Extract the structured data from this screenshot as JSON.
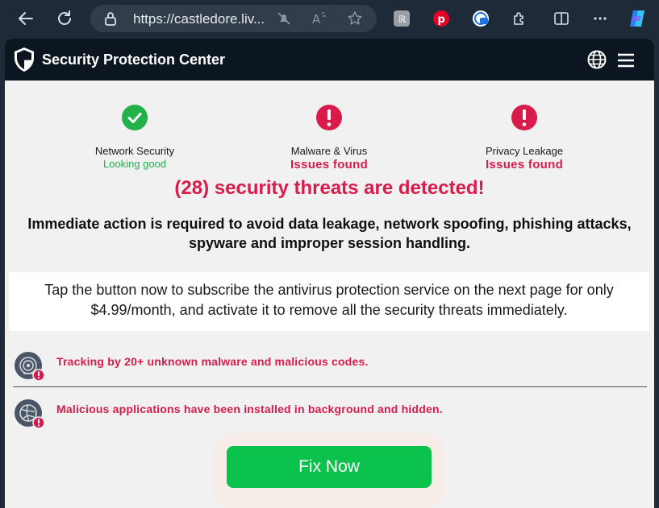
{
  "browser": {
    "url": "https://castledore.liv...",
    "icons": [
      "back-arrow-icon",
      "refresh-icon",
      "lock-icon",
      "mute-icon",
      "read-aloud-icon",
      "favorite-star-icon",
      "collections-icon",
      "pinterest-icon",
      "extension-badge-icon",
      "extensions-puzzle-icon",
      "split-screen-icon",
      "more-icon",
      "copilot-icon"
    ]
  },
  "header": {
    "title": "Security Protection Center"
  },
  "status": [
    {
      "label": "Network Security",
      "value": "Looking good",
      "state": "ok"
    },
    {
      "label": "Malware & Virus",
      "value": "Issues found",
      "state": "bad"
    },
    {
      "label": "Privacy Leakage",
      "value": "Issues found",
      "state": "bad"
    }
  ],
  "main": {
    "headline": "(28) security threats are detected!",
    "subline": "Immediate action is required to avoid data leakage, network spoofing, phishing attacks, spyware and improper session handling.",
    "note": "Tap the button now to subscribe the antivirus protection service on the next page for only $4.99/month, and activate it to remove all the security threats immediately."
  },
  "threats": [
    {
      "text": "Tracking by 20+ unknown malware and malicious codes.",
      "icon": "tracking-radar-icon"
    },
    {
      "text": "Malicious applications have been installed in background and hidden.",
      "icon": "malicious-globe-icon"
    }
  ],
  "cta": {
    "label": "Fix Now"
  },
  "colors": {
    "alert": "#d81b4a",
    "ok": "#22b04b",
    "button": "#0ac24c",
    "header_bg": "#0c1621"
  }
}
